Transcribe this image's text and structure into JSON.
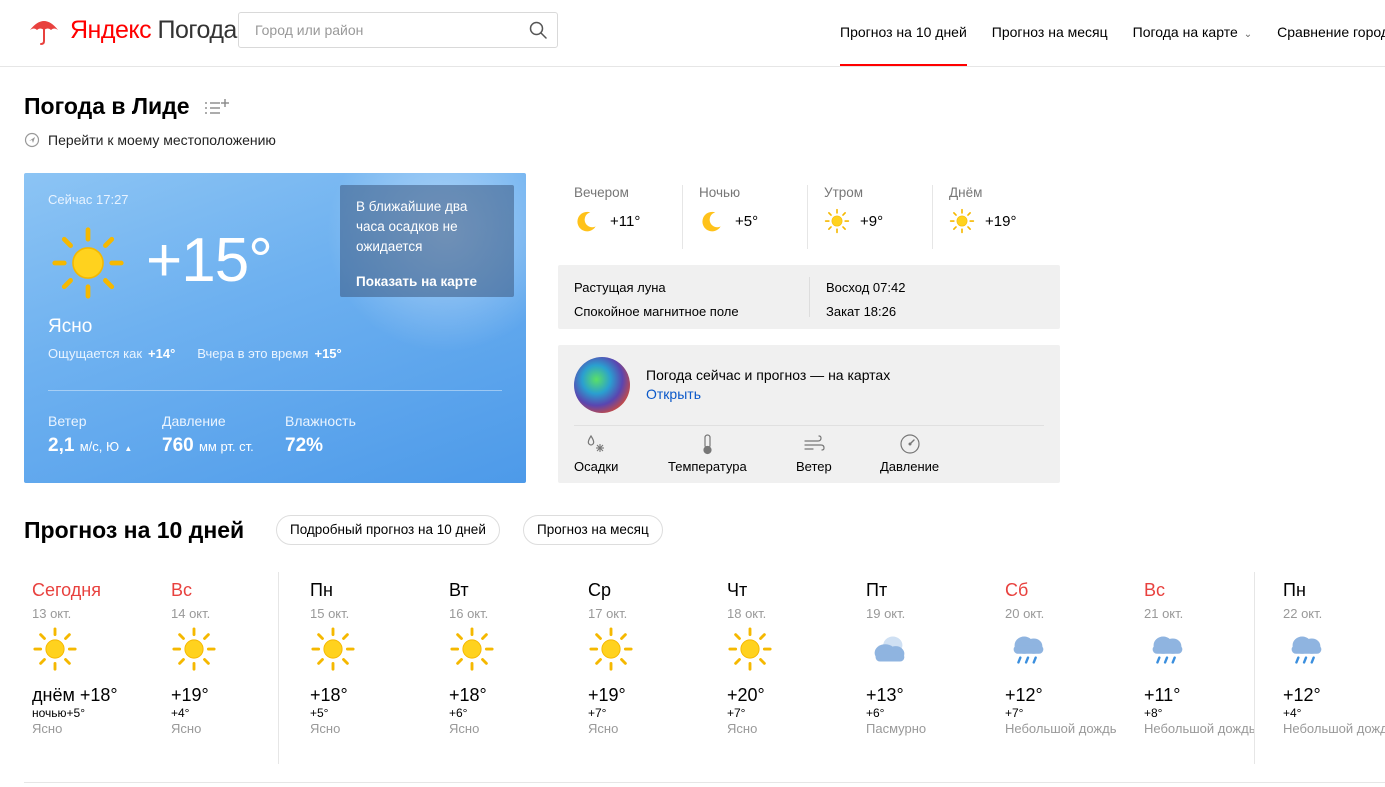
{
  "header": {
    "logo_brand": "Яндекс",
    "logo_product": "Погода",
    "search_placeholder": "Город или район",
    "nav": [
      "Прогноз на 10 дней",
      "Прогноз на месяц",
      "Погода на карте",
      "Сравнение городов"
    ]
  },
  "page": {
    "title": "Погода в Лиде",
    "geo_link": "Перейти к моему местоположению"
  },
  "current": {
    "time": "Сейчас 17:27",
    "temp": "+15°",
    "condition": "Ясно",
    "feels_label": "Ощущается как",
    "feels_value": "+14°",
    "yesterday_label": "Вчера в это время",
    "yesterday_value": "+15°",
    "precip_text": "В ближайшие два часа осадков не ожидается",
    "precip_link": "Показать на карте",
    "wind_label": "Ветер",
    "wind_value": "2,1",
    "wind_unit": "м/с, Ю",
    "pressure_label": "Давление",
    "pressure_value": "760",
    "pressure_unit": "мм рт. ст.",
    "humidity_label": "Влажность",
    "humidity_value": "72%"
  },
  "periods": [
    {
      "name": "Вечером",
      "temp": "+11°",
      "icon": "moon-icon"
    },
    {
      "name": "Ночью",
      "temp": "+5°",
      "icon": "moon-icon"
    },
    {
      "name": "Утром",
      "temp": "+9°",
      "icon": "sun-icon"
    },
    {
      "name": "Днём",
      "temp": "+19°",
      "icon": "sun-icon"
    }
  ],
  "astro": {
    "moon": "Растущая луна",
    "magnetic": "Спокойное магнитное поле",
    "sunrise": "Восход 07:42",
    "sunset": "Закат 18:26"
  },
  "maps": {
    "title": "Погода сейчас и прогноз — на картах",
    "open": "Открыть",
    "links": [
      "Осадки",
      "Температура",
      "Ветер",
      "Давление"
    ]
  },
  "forecast": {
    "title": "Прогноз на 10 дней",
    "pill_detailed": "Подробный прогноз на 10 дней",
    "pill_month": "Прогноз на месяц",
    "days": [
      {
        "name": "Сегодня",
        "date": "13 окт.",
        "day": "днём +18°",
        "night": "ночью+5°",
        "cond": "Ясно",
        "weekend": true,
        "icon": "sun-icon"
      },
      {
        "name": "Вс",
        "date": "14 окт.",
        "day": "+19°",
        "night": "+4°",
        "cond": "Ясно",
        "weekend": true,
        "icon": "sun-icon"
      },
      {
        "name": "Пн",
        "date": "15 окт.",
        "day": "+18°",
        "night": "+5°",
        "cond": "Ясно",
        "weekend": false,
        "icon": "sun-icon"
      },
      {
        "name": "Вт",
        "date": "16 окт.",
        "day": "+18°",
        "night": "+6°",
        "cond": "Ясно",
        "weekend": false,
        "icon": "sun-icon"
      },
      {
        "name": "Ср",
        "date": "17 окт.",
        "day": "+19°",
        "night": "+7°",
        "cond": "Ясно",
        "weekend": false,
        "icon": "sun-icon"
      },
      {
        "name": "Чт",
        "date": "18 окт.",
        "day": "+20°",
        "night": "+7°",
        "cond": "Ясно",
        "weekend": false,
        "icon": "sun-icon"
      },
      {
        "name": "Пт",
        "date": "19 окт.",
        "day": "+13°",
        "night": "+6°",
        "cond": "Пасмурно",
        "weekend": false,
        "icon": "cloud-icon"
      },
      {
        "name": "Сб",
        "date": "20 окт.",
        "day": "+12°",
        "night": "+7°",
        "cond": "Небольшой дождь",
        "weekend": true,
        "icon": "rain-icon"
      },
      {
        "name": "Вс",
        "date": "21 окт.",
        "day": "+11°",
        "night": "+8°",
        "cond": "Небольшой дождь",
        "weekend": true,
        "icon": "rain-icon"
      },
      {
        "name": "Пн",
        "date": "22 окт.",
        "day": "+12°",
        "night": "+4°",
        "cond": "Небольшой дождь",
        "weekend": false,
        "icon": "rain-icon"
      }
    ]
  },
  "colors": {
    "accent_red": "#ff0000",
    "weekend_red": "#e8413e",
    "link_blue": "#0a58c9",
    "sun_yellow": "#ffd21e"
  }
}
